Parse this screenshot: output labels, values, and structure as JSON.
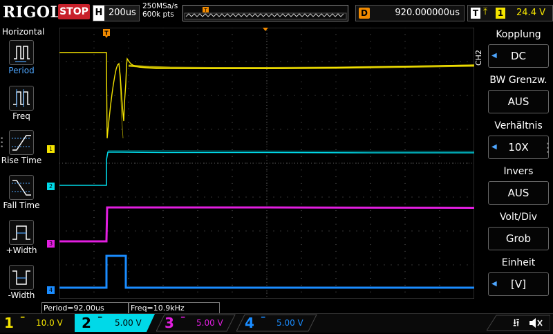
{
  "top": {
    "logo": "RIGOL",
    "run_status": "STOP",
    "horizontal": {
      "key": "H",
      "scale": "200us"
    },
    "sample_rate": "250MSa/s",
    "memory_depth": "600k pts",
    "delay": {
      "key": "D",
      "value": "920.000000us"
    },
    "trigger": {
      "key": "T",
      "source": "1",
      "level": "24.4 V",
      "edge_icon": "rising-edge-icon"
    }
  },
  "left_menu": {
    "title": "Horizontal",
    "items": [
      {
        "label": "Period",
        "icon": "period-icon"
      },
      {
        "label": "Freq",
        "icon": "frequency-icon"
      },
      {
        "label": "Rise Time",
        "icon": "rise-time-icon"
      },
      {
        "label": "Fall Time",
        "icon": "fall-time-icon"
      },
      {
        "label": "+Width",
        "icon": "positive-width-icon"
      },
      {
        "label": "-Width",
        "icon": "negative-width-icon"
      }
    ]
  },
  "right_menu": {
    "channel_tab": "CH2",
    "items": [
      {
        "title": "Kopplung",
        "value": "DC"
      },
      {
        "title": "BW Grenzw.",
        "value": "AUS"
      },
      {
        "title": "Verhältnis",
        "value": "10X"
      },
      {
        "title": "Invers",
        "value": "AUS"
      },
      {
        "title": "Volt/Div",
        "value": "Grob"
      },
      {
        "title": "Einheit",
        "value": "[V]"
      }
    ]
  },
  "measurements": {
    "period": "Period=92.00us",
    "freq": "Freq=10.9kHz"
  },
  "channels": [
    {
      "num": "1",
      "scale": "10.0 V",
      "color": "#f5e400",
      "active": false
    },
    {
      "num": "2",
      "scale": "5.00 V",
      "color": "#00d9e8",
      "active": true
    },
    {
      "num": "3",
      "scale": "5.00 V",
      "color": "#e21ee0",
      "active": false
    },
    {
      "num": "4",
      "scale": "5.00 V",
      "color": "#1a8cff",
      "active": false
    }
  ],
  "waveform_markers": {
    "ch1": "1",
    "ch2": "2",
    "ch3": "3",
    "ch4": "4",
    "trigger": "T"
  },
  "status_icons": [
    "usb-icon",
    "speaker-mute-icon"
  ]
}
